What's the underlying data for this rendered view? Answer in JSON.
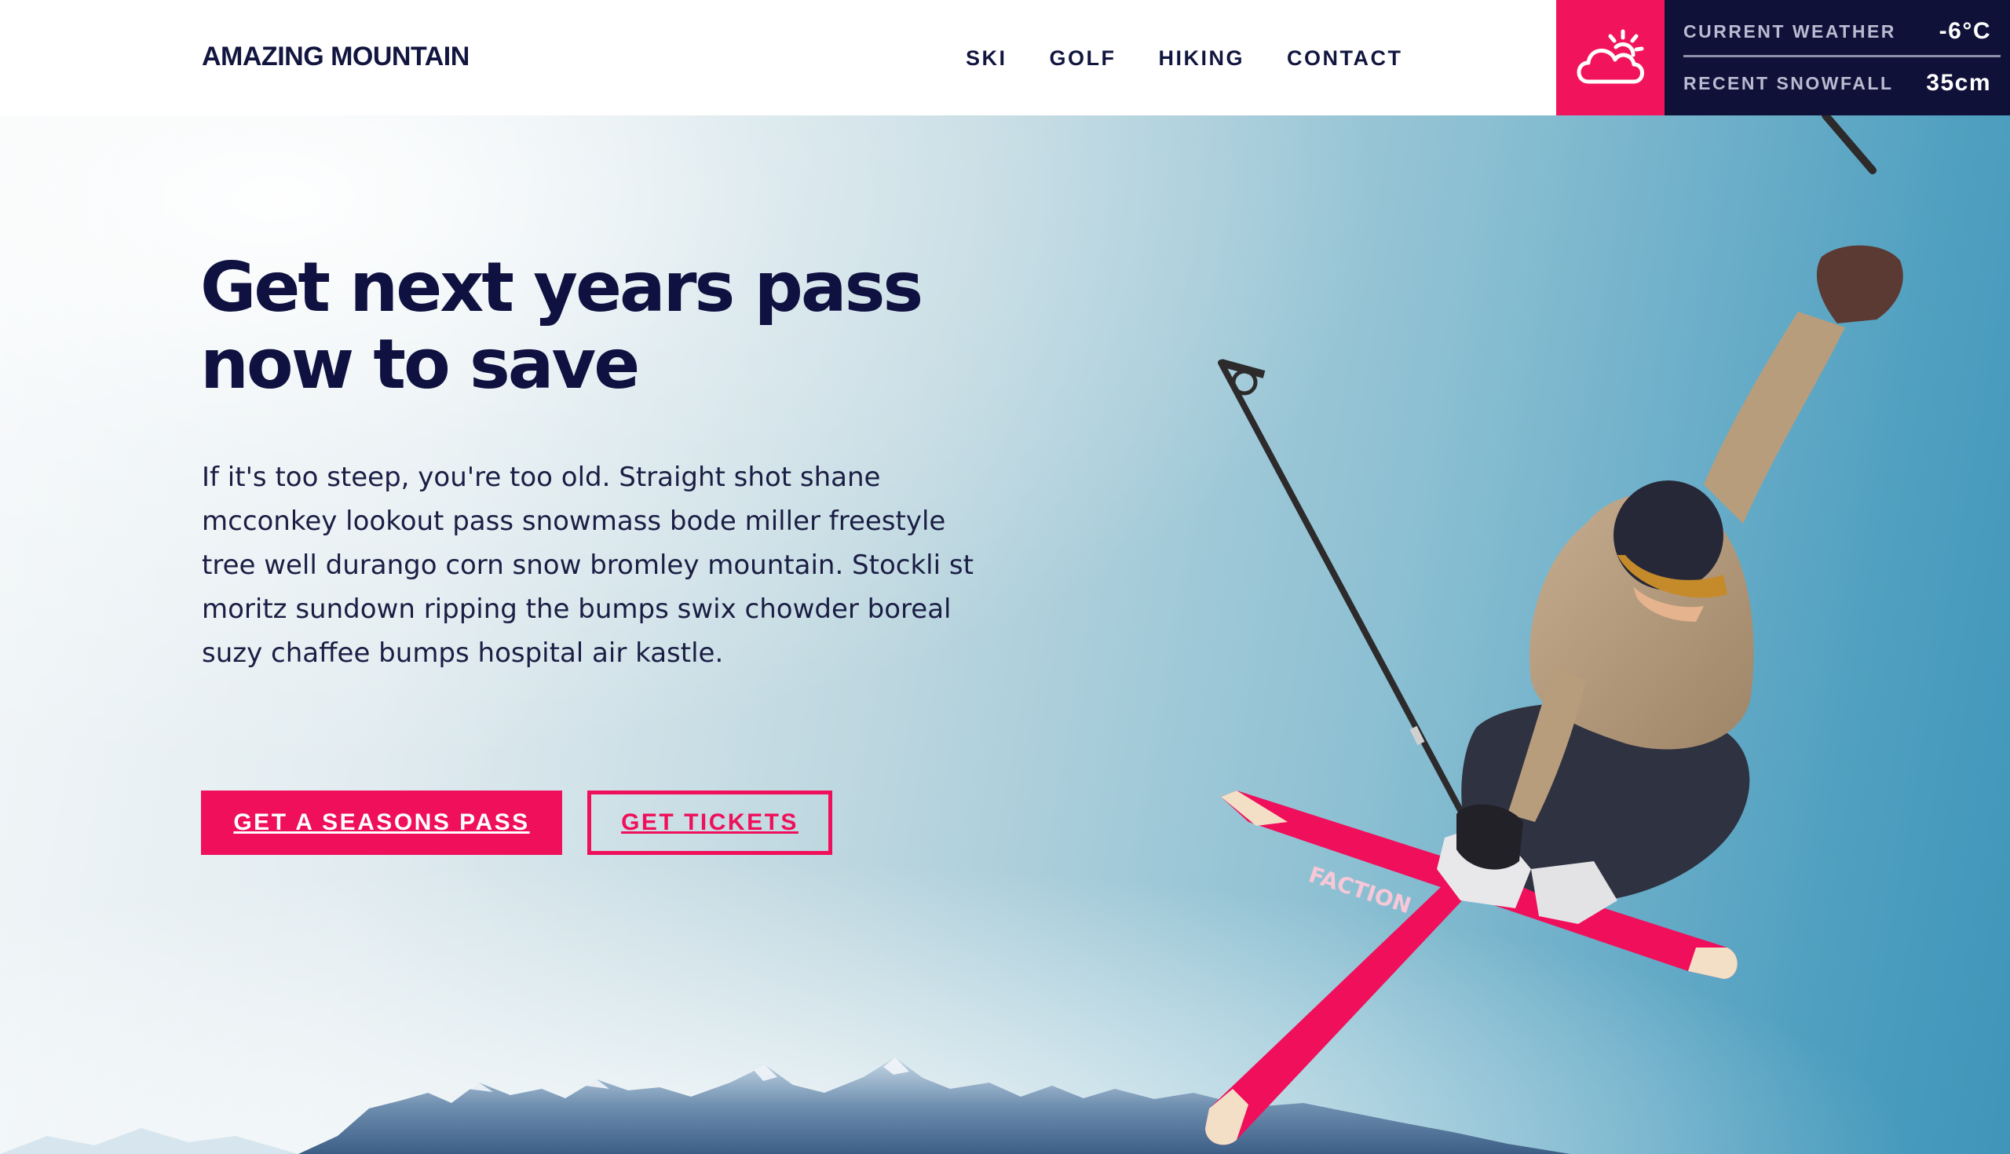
{
  "header": {
    "brand": "AMAZING MOUNTAIN",
    "nav": [
      "SKI",
      "GOLF",
      "HIKING",
      "CONTACT"
    ],
    "weather": {
      "icon": "partly-cloudy-icon",
      "current_label": "CURRENT WEATHER",
      "current_value": "-6°C",
      "snow_label": "RECENT SNOWFALL",
      "snow_value": "35cm"
    }
  },
  "hero": {
    "headline": "Get next years pass now to save",
    "body": "If it's too steep, you're too old. Straight shot shane mcconkey lookout pass snowmass bode miller freestyle tree well durango corn snow bromley mountain. Stockli st moritz sundown ripping the bumps swix chowder boreal suzy chaffee bumps hospital air kastle.",
    "primary_button": "GET A SEASONS PASS",
    "secondary_button": "GET TICKETS",
    "ski_graphic_text": "FACTION"
  },
  "colors": {
    "accent": "#ef0f5b",
    "navy": "#101139",
    "text": "#12163f"
  }
}
